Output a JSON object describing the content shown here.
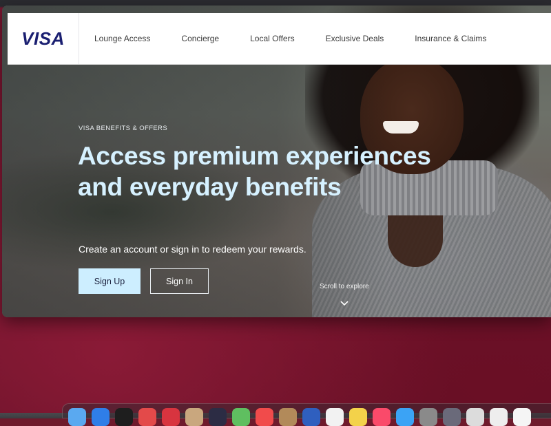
{
  "brand": {
    "logo": "VISA",
    "color": "#1a1f71"
  },
  "nav": {
    "items": [
      {
        "label": "Lounge Access"
      },
      {
        "label": "Concierge"
      },
      {
        "label": "Local Offers"
      },
      {
        "label": "Exclusive Deals"
      },
      {
        "label": "Insurance & Claims"
      }
    ]
  },
  "hero": {
    "eyebrow": "VISA BENEFITS & OFFERS",
    "headline": "Access premium experiences and everyday benefits",
    "subtext": "Create an account or sign in to redeem your rewards.",
    "primary_button": "Sign Up",
    "secondary_button": "Sign In",
    "scroll_label": "Scroll to explore",
    "headline_color": "#d6f1ff",
    "primary_button_color": "#cdeeff"
  },
  "dock": {
    "icons": [
      {
        "name": "finder-icon",
        "color": "#5aa9f0"
      },
      {
        "name": "safari-icon",
        "color": "#2f7ee8"
      },
      {
        "name": "terminal-icon",
        "color": "#1e1e1e"
      },
      {
        "name": "app-red-icon",
        "color": "#e34a4a"
      },
      {
        "name": "app-red2-icon",
        "color": "#d8343f"
      },
      {
        "name": "contacts-icon",
        "color": "#c9a77e"
      },
      {
        "name": "app-dark-icon",
        "color": "#2c2c44"
      },
      {
        "name": "maps-icon",
        "color": "#5fbf60"
      },
      {
        "name": "calendar-icon",
        "color": "#f14b4b"
      },
      {
        "name": "notes-brown-icon",
        "color": "#b28a5a"
      },
      {
        "name": "app-blue-icon",
        "color": "#2f5fbf"
      },
      {
        "name": "reminders-icon",
        "color": "#f2f2f2"
      },
      {
        "name": "notes-icon",
        "color": "#f3d24a"
      },
      {
        "name": "music-icon",
        "color": "#fa4a6a"
      },
      {
        "name": "appstore-icon",
        "color": "#3ba3f5"
      },
      {
        "name": "settings-icon",
        "color": "#8a8a8a"
      },
      {
        "name": "app-gray-icon",
        "color": "#6a6a7a"
      },
      {
        "name": "preview-icon",
        "color": "#dcdcdc"
      },
      {
        "name": "app-white-icon",
        "color": "#eeeeee"
      },
      {
        "name": "document-icon",
        "color": "#f5f5f5"
      }
    ]
  }
}
